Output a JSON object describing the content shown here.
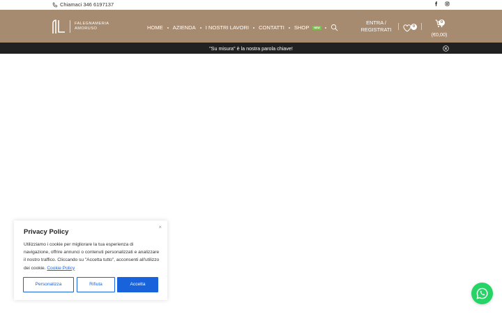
{
  "topbar": {
    "phone_text": "Chiamaci 346 6197137",
    "social_icons": [
      "facebook-icon",
      "instagram-icon"
    ]
  },
  "header": {
    "logo_line1": "FALEGNAMERIA",
    "logo_line2": "AMORUSO",
    "nav": [
      "HOME",
      "AZIENDA",
      "I NOSTRI LAVORI",
      "CONTATTI",
      "SHOP"
    ],
    "new_badge": "NEW",
    "account_line1": "ENTRA /",
    "account_line2": "REGISTRATI",
    "wishlist_count": "0",
    "cart_count": "0",
    "cart_total": "(€0,00)"
  },
  "announcement": {
    "message": "\"Su misura\" è la nostra parola chiave!"
  },
  "privacy": {
    "title": "Privacy Policy",
    "body": "Utilizziamo i cookie per migliorare la tua esperienza di navigazione, offrire annunci o contenuti personalizzati e analizzare il nostro traffico. Cliccando su \"Accetta tutto\", acconsenti all'utilizzo dei cookie.",
    "link": "Cookie Policy",
    "close": "×",
    "btn_customize": "Personalizza",
    "btn_reject": "Rifiuta",
    "btn_accept": "Accetta"
  },
  "colors": {
    "header_bg": "#a78b71",
    "announce_bg": "#212121",
    "accent_blue": "#1863dc",
    "whatsapp": "#25d366",
    "new_badge": "#7cc14b"
  }
}
